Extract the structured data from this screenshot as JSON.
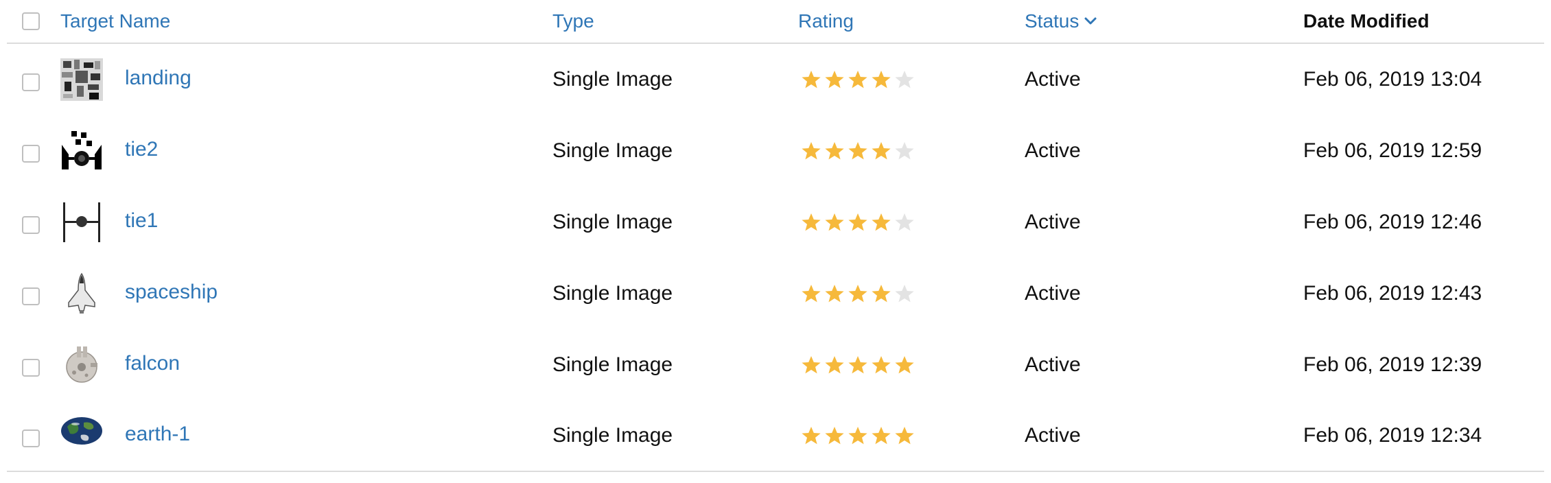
{
  "header": {
    "name": "Target Name",
    "type": "Type",
    "rating": "Rating",
    "status": "Status",
    "date": "Date Modified"
  },
  "colors": {
    "link": "#2f76b6",
    "star_filled": "#f6b93b",
    "star_empty": "#e3e3e3",
    "border": "#dcdcdc"
  },
  "rows": [
    {
      "name": "landing",
      "icon": "landing-target-icon",
      "type": "Single Image",
      "rating": 4,
      "rating_max": 5,
      "status": "Active",
      "date": "Feb 06, 2019 13:04"
    },
    {
      "name": "tie2",
      "icon": "tie2-target-icon",
      "type": "Single Image",
      "rating": 4,
      "rating_max": 5,
      "status": "Active",
      "date": "Feb 06, 2019 12:59"
    },
    {
      "name": "tie1",
      "icon": "tie1-target-icon",
      "type": "Single Image",
      "rating": 4,
      "rating_max": 5,
      "status": "Active",
      "date": "Feb 06, 2019 12:46"
    },
    {
      "name": "spaceship",
      "icon": "spaceship-target-icon",
      "type": "Single Image",
      "rating": 4,
      "rating_max": 5,
      "status": "Active",
      "date": "Feb 06, 2019 12:43"
    },
    {
      "name": "falcon",
      "icon": "falcon-target-icon",
      "type": "Single Image",
      "rating": 5,
      "rating_max": 5,
      "status": "Active",
      "date": "Feb 06, 2019 12:39"
    },
    {
      "name": "earth-1",
      "icon": "earth-target-icon",
      "type": "Single Image",
      "rating": 5,
      "rating_max": 5,
      "status": "Active",
      "date": "Feb 06, 2019 12:34"
    }
  ]
}
